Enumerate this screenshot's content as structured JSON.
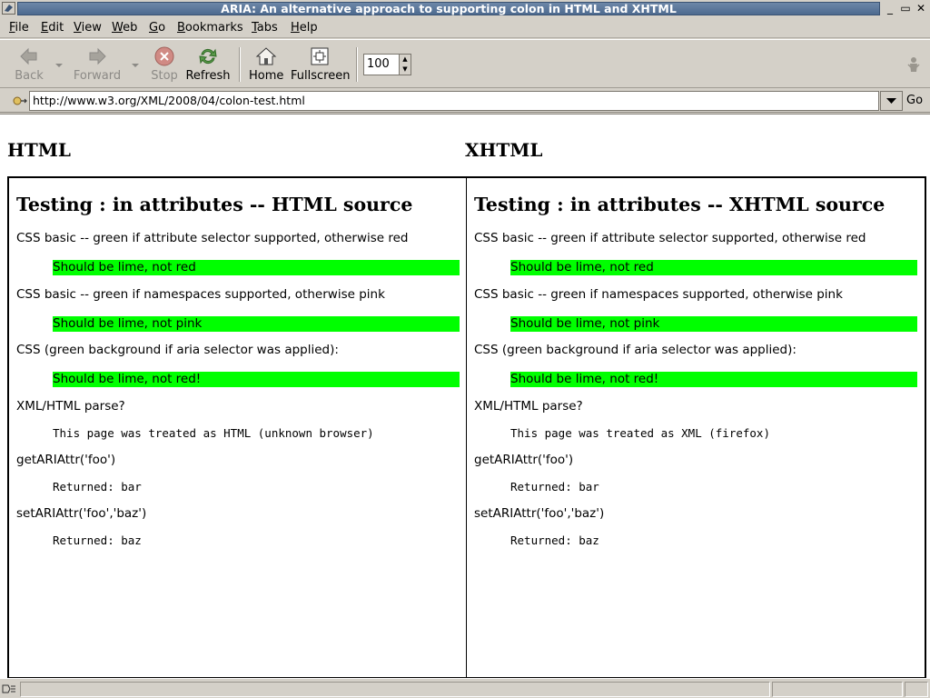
{
  "window": {
    "title": "ARIA: An alternative approach to supporting colon in HTML and XHTML"
  },
  "menu": [
    {
      "label": "File",
      "key": "F",
      "rest": "ile"
    },
    {
      "label": "Edit",
      "key": "E",
      "rest": "dit"
    },
    {
      "label": "View",
      "key": "V",
      "rest": "iew"
    },
    {
      "label": "Web",
      "key": "W",
      "rest": "eb"
    },
    {
      "label": "Go",
      "key": "G",
      "rest": "o"
    },
    {
      "label": "Bookmarks",
      "key": "B",
      "rest": "ookmarks"
    },
    {
      "label": "Tabs",
      "key": "T",
      "rest": "abs"
    },
    {
      "label": "Help",
      "key": "H",
      "rest": "elp"
    }
  ],
  "toolbar": {
    "back_label": "Back",
    "forward_label": "Forward",
    "stop_label": "Stop",
    "refresh_label": "Refresh",
    "home_label": "Home",
    "fullscreen_label": "Fullscreen",
    "zoom_value": "100"
  },
  "urlbar": {
    "url": "http://www.w3.org/XML/2008/04/colon-test.html",
    "go_label": "Go"
  },
  "page": {
    "left_heading": "HTML",
    "right_heading": "XHTML",
    "left": {
      "title": "Testing : in attributes -- HTML source",
      "css_attr_label": "CSS basic -- green if attribute selector supported, otherwise red",
      "css_attr_result": "Should be lime, not red",
      "css_ns_label": "CSS basic -- green if namespaces supported, otherwise pink",
      "css_ns_result": "Should be lime, not pink",
      "css_aria_label": "CSS (green background if aria selector was applied):",
      "css_aria_result": "Should be lime, not red!",
      "parse_label": "XML/HTML parse?",
      "parse_result": "This page was treated as HTML (unknown browser)",
      "get_label": "getARIAttr('foo')",
      "get_result": "Returned: bar",
      "set_label": "setARIAttr('foo','baz')",
      "set_result": "Returned: baz"
    },
    "right": {
      "title": "Testing : in attributes -- XHTML source",
      "css_attr_label": "CSS basic -- green if attribute selector supported, otherwise red",
      "css_attr_result": "Should be lime, not red",
      "css_ns_label": "CSS basic -- green if namespaces supported, otherwise pink",
      "css_ns_result": "Should be lime, not pink",
      "css_aria_label": "CSS (green background if aria selector was applied):",
      "css_aria_result": "Should be lime, not red!",
      "parse_label": "XML/HTML parse?",
      "parse_result": "This page was treated as XML (firefox)",
      "get_label": "getARIAttr('foo')",
      "get_result": "Returned: bar",
      "set_label": "setARIAttr('foo','baz')",
      "set_result": "Returned: baz"
    }
  },
  "colors": {
    "lime": "#00ff00",
    "title_bar": "#5a779c",
    "chrome": "#d4d0c8"
  },
  "icons": {
    "back": "left-arrow-icon",
    "forward": "right-arrow-icon",
    "stop": "stop-icon",
    "refresh": "refresh-icon",
    "home": "home-icon",
    "fullscreen": "fullscreen-icon"
  }
}
